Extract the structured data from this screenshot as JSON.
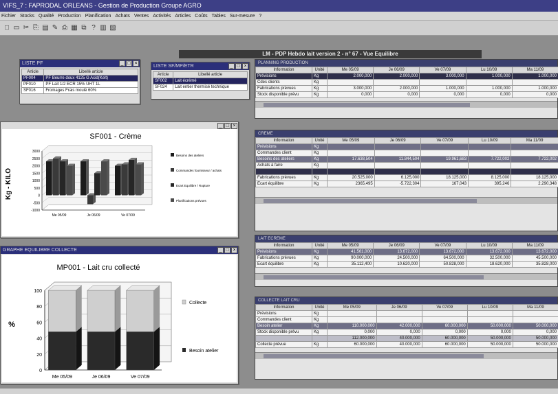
{
  "app": {
    "title": "VIFS_7 : FAPRODAL ORLEANS - Gestion de Production Groupe AGRO",
    "menu": [
      "Fichier",
      "Stocks",
      "Qualité",
      "Production",
      "Planification",
      "Achats",
      "Ventes",
      "Activités",
      "Articles",
      "Coûts",
      "Tables",
      "Sur-mesure",
      "?"
    ],
    "toolbar_icons": [
      "new-icon",
      "open-icon",
      "cut-icon",
      "copy-icon",
      "paste-icon",
      "edit-icon",
      "print-icon",
      "print-preview-icon",
      "filter-icon",
      "help-icon",
      "window-tile-icon",
      "window-cascade-icon"
    ]
  },
  "main_title": "LM - PDP Hebdo lait version 2 - n° 67 - Vue Equilibre",
  "win_pf": {
    "title": "LISTE PF",
    "headers": [
      "Article",
      "Libellé article"
    ],
    "rows": [
      [
        "PF004",
        "PF Beurre doux 4125 G Acid(Kelt)"
      ],
      [
        "PF010",
        "PF Lait 1/2 ECR 15% UHT 1L"
      ],
      [
        "SF016",
        "Fromages Frais moulé 60%"
      ]
    ],
    "selected": 0
  },
  "win_sf": {
    "title": "LISTE SF/MP/ETR",
    "headers": [
      "Article",
      "Libellé article"
    ],
    "rows": [
      [
        "SF002",
        "Lait écrémé"
      ],
      [
        "SF024",
        "Lait entier thermisé technique"
      ]
    ],
    "selected": 0
  },
  "chart_cream": {
    "title": "SF001 - Crème",
    "ylabel": "Kg - KILO",
    "legend": [
      "Besoins des ateliers",
      "Commandes fournisseur / achats",
      "Ecart Equilibre / Rupture",
      "Planifications prévues"
    ]
  },
  "chart_collect": {
    "window_title": "GRAPHE EQUILIBRE COLLECTE",
    "title": "MP001 - Lait cru collecté",
    "ylabel": "%",
    "legend": [
      "Collecte",
      "Besoin atelier"
    ]
  },
  "chart_data": [
    {
      "type": "bar",
      "title": "SF001 - Crème",
      "ylabel": "Kg - KILO",
      "categories": [
        "Me 05/09",
        "Je 06/09",
        "Ve 07/09"
      ],
      "yticks": [
        -1000,
        -500,
        0,
        500,
        1000,
        1500,
        2000,
        2500,
        3000
      ],
      "ylim": [
        -1000,
        3000
      ],
      "series": [
        {
          "name": "Besoins des ateliers",
          "values": [
            2300,
            2300,
            2000
          ]
        },
        {
          "name": "Commandes fournisseur / achats",
          "values": [
            2500,
            -600,
            2100
          ]
        },
        {
          "name": "Ecart Equilibre / Rupture",
          "values": [
            2300,
            1500,
            2400
          ]
        },
        {
          "name": "Planifications prévues",
          "values": [
            2000,
            2300,
            2100
          ]
        }
      ],
      "legend_position": "right",
      "grid": true
    },
    {
      "type": "bar",
      "title": "MP001 - Lait cru collecté",
      "ylabel": "%",
      "categories": [
        "Me 05/09",
        "Je 06/09",
        "Ve 07/09"
      ],
      "yticks": [
        0,
        20,
        40,
        60,
        80,
        100
      ],
      "ylim": [
        0,
        100
      ],
      "stacked": true,
      "series": [
        {
          "name": "Besoin atelier",
          "values": [
            48,
            48,
            48
          ]
        },
        {
          "name": "Collecte",
          "values": [
            52,
            52,
            52
          ]
        }
      ],
      "legend_position": "right",
      "grid": true
    }
  ],
  "days": [
    "Me 05/09",
    "Je 06/09",
    "Ve 07/09",
    "Lu 10/09",
    "Ma 11/09"
  ],
  "planning": {
    "title": "PLANNING PRODUCTION",
    "headers": [
      "Information",
      "Unité"
    ],
    "rows": [
      {
        "label": "Prévisions",
        "unit": "Kg",
        "values": [
          "2.000,000",
          "2.000,000",
          "3.000,000",
          "1.000,000",
          "1.000,000"
        ],
        "style": "r-dark"
      },
      {
        "label": "Cdes clients",
        "unit": "Kg",
        "values": [
          "",
          "",
          "",
          "",
          ""
        ],
        "style": "r-light"
      },
      {
        "label": "Fabrications prévues",
        "unit": "Kg",
        "values": [
          "3.000,000",
          "2.000,000",
          "1.000,000",
          "1.000,000",
          "1.000,000"
        ],
        "style": "r-light"
      },
      {
        "label": "Stock disponible prévu",
        "unit": "Kg",
        "values": [
          "0,000",
          "0,000",
          "0,000",
          "0,000",
          "0,000"
        ],
        "style": "r-light"
      }
    ]
  },
  "creme": {
    "title": "CREME",
    "headers": [
      "Information",
      "Unité"
    ],
    "rows": [
      {
        "label": "Prévisions",
        "unit": "Kg",
        "values": [
          "",
          "",
          "",
          "",
          ""
        ],
        "style": "r-mid"
      },
      {
        "label": "Commandes client",
        "unit": "Kg",
        "values": [
          "",
          "",
          "",
          "",
          ""
        ],
        "style": "r-light"
      },
      {
        "label": "Besoins des ateliers",
        "unit": "Kg",
        "values": [
          "17.638,504",
          "11.844,504",
          "19.961,683",
          "7.722,002",
          "7.722,002"
        ],
        "style": "r-mid"
      },
      {
        "label": "Achats à faire",
        "unit": "Kg",
        "values": [
          "",
          "",
          "",
          "",
          ""
        ],
        "style": "r-light"
      },
      {
        "label": "",
        "unit": "",
        "values": [
          "",
          "",
          "",
          "",
          ""
        ],
        "style": "r-dark"
      },
      {
        "label": "Fabrications prévues",
        "unit": "Kg",
        "values": [
          "20.525,000",
          "6.125,000",
          "18.125,000",
          "8.125,000",
          "18.125,000"
        ],
        "style": "r-light"
      },
      {
        "label": "Ecart équilibre",
        "unit": "Kg",
        "values": [
          "2365,495",
          "-5.722,304",
          "167,043",
          "395,246",
          "2.290,348"
        ],
        "style": "r-light"
      }
    ]
  },
  "lait_ecreme": {
    "title": "LAIT ECREME",
    "headers": [
      "Information",
      "Unité"
    ],
    "rows": [
      {
        "label": "Prévisions",
        "unit": "Kg",
        "values": [
          "41.561,000",
          "13.672,000",
          "13.672,000",
          "13.672,000",
          "13.672,000"
        ],
        "style": "r-mid"
      },
      {
        "label": "Fabrications prévues",
        "unit": "Kg",
        "values": [
          "90.000,000",
          "24.500,000",
          "64.500,000",
          "32.500,000",
          "45.500,000"
        ],
        "style": "r-light"
      },
      {
        "label": "Ecart équilibre",
        "unit": "Kg",
        "values": [
          "35.112,400",
          "10.620,000",
          "50.828,000",
          "18.620,000",
          "35.828,000"
        ],
        "style": "r-light"
      }
    ]
  },
  "collecte": {
    "title": "COLLECTE LAIT CRU",
    "headers": [
      "Information",
      "Unité"
    ],
    "rows": [
      {
        "label": "Prévisions",
        "unit": "Kg",
        "values": [
          "",
          "",
          "",
          "",
          ""
        ],
        "style": "r-light"
      },
      {
        "label": "Commandes client",
        "unit": "Kg",
        "values": [
          "",
          "",
          "",
          "",
          ""
        ],
        "style": "r-light"
      },
      {
        "label": "Besoin atelier",
        "unit": "Kg",
        "values": [
          "110.000,000",
          "42.000,000",
          "60.000,000",
          "50.000,000",
          "50.000,000"
        ],
        "style": "r-mid"
      },
      {
        "label": "Stock disponible prévu",
        "unit": "Kg",
        "values": [
          "0,000",
          "0,000",
          "0,000",
          "0,000",
          "0,000"
        ],
        "style": "r-light"
      },
      {
        "label": "",
        "unit": "",
        "values": [
          "112.000,000",
          "40.000,000",
          "60.000,000",
          "50.000,000",
          "50.000,000"
        ],
        "style": "r-grey"
      },
      {
        "label": "Collecte prévue",
        "unit": "Kg",
        "values": [
          "60.000,000",
          "40.000,000",
          "60.000,000",
          "50.000,000",
          "50.000,000"
        ],
        "style": "r-light"
      }
    ]
  },
  "colors": {
    "window_title": "#2b2f7a",
    "highlight_dark": "#2f2f4a",
    "highlight_mid": "#6e6e86",
    "chart_bar": "#1c1c1c"
  }
}
